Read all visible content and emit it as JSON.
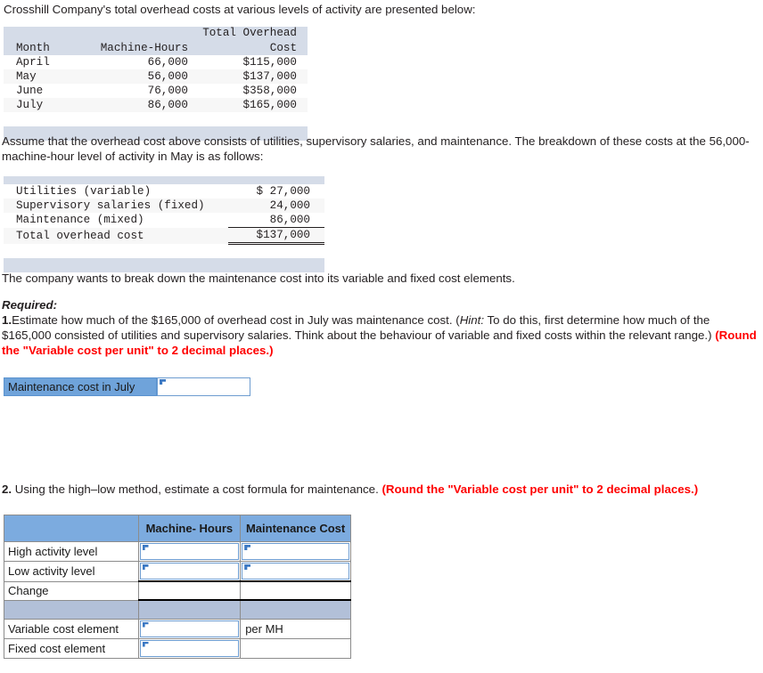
{
  "intro": "Crosshill Company's total overhead costs at various levels of activity are presented below:",
  "overhead_table": {
    "headers": {
      "month": "Month",
      "hours": "Machine-Hours",
      "cost_line1": "Total Overhead",
      "cost_line2": "Cost"
    },
    "rows": [
      {
        "month": "April",
        "hours": "66,000",
        "cost": "$115,000"
      },
      {
        "month": "May",
        "hours": "56,000",
        "cost": "$137,000"
      },
      {
        "month": "June",
        "hours": "76,000",
        "cost": "$358,000"
      },
      {
        "month": "July",
        "hours": "86,000",
        "cost": "$165,000"
      }
    ]
  },
  "para_assume": "Assume that the overhead cost above consists of utilities, supervisory salaries, and maintenance. The breakdown of these costs at the 56,000-machine-hour level of activity in May is as follows:",
  "breakdown_table": {
    "rows": [
      {
        "label": "Utilities (variable)",
        "amount": "$ 27,000"
      },
      {
        "label": "Supervisory salaries (fixed)",
        "amount": "24,000"
      },
      {
        "label": "Maintenance (mixed)",
        "amount": "86,000"
      }
    ],
    "total": {
      "label": "Total overhead cost",
      "amount": "$137,000"
    }
  },
  "para_breakdown": "The company wants to break down the maintenance cost into its variable and fixed cost elements.",
  "required": {
    "title": "Required:",
    "q1_num": "1.",
    "q1_text_a": "Estimate how much of the $165,000 of overhead cost in July was maintenance cost. (",
    "q1_hint_label": "Hint:",
    "q1_text_b": " To do this, first determine how much of the $165,000 consisted of utilities and supervisory salaries. Think about the behaviour of variable and fixed costs within the relevant range.) ",
    "q1_round_note": "(Round the \"Variable cost per unit\" to 2 decimal places.)"
  },
  "answer1": {
    "label": "Maintenance cost in July",
    "value": "",
    "placeholder": ""
  },
  "question2": {
    "num": "2.",
    "text": " Using the high–low method, estimate a cost formula for maintenance. ",
    "round_note": "(Round the \"Variable cost per unit\" to 2 decimal places.)"
  },
  "q2_table": {
    "headers": {
      "blank": "",
      "machine_hours": "Machine- Hours",
      "maintenance_cost": "Maintenance Cost"
    },
    "rows": [
      {
        "label": "High activity level",
        "mh_type": "input",
        "mh_value": "",
        "mc_type": "input",
        "mc_value": ""
      },
      {
        "label": "Low activity level",
        "mh_type": "input",
        "mh_value": "",
        "mc_type": "input",
        "mc_value": ""
      },
      {
        "label": "Change",
        "mh_type": "blank",
        "mh_value": "",
        "mc_type": "blank",
        "mc_value": ""
      }
    ],
    "rows2": [
      {
        "label": "Variable cost element",
        "mh_type": "input",
        "mh_value": "",
        "mc_type": "text",
        "mc_value": "per MH"
      },
      {
        "label": "Fixed cost element",
        "mh_type": "input",
        "mh_value": "",
        "mc_type": "blank",
        "mc_value": ""
      }
    ]
  },
  "colors": {
    "header_blue": "#7cabdf",
    "label_blue": "#6fa3da",
    "spacer_blue": "#b2c0d8",
    "table_header_grey": "#d5dce8",
    "red_note": "#ff0000"
  }
}
